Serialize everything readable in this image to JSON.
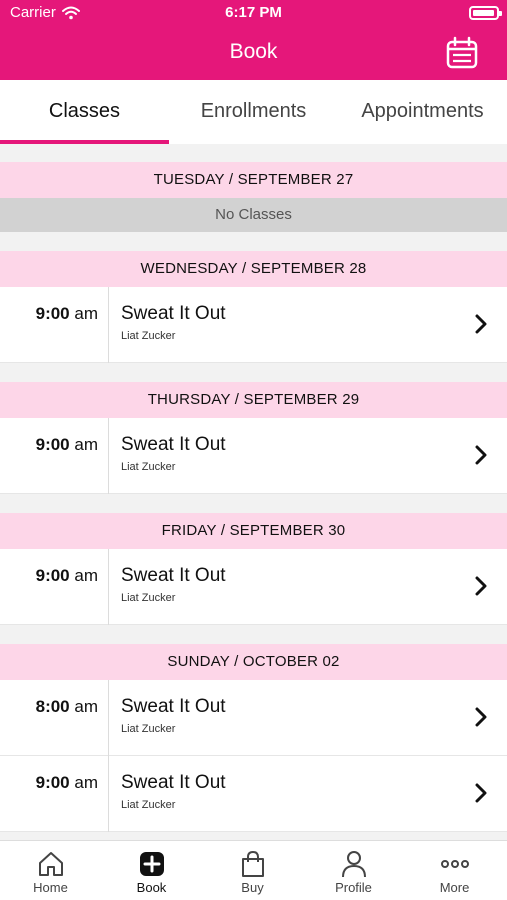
{
  "status_bar": {
    "carrier": "Carrier",
    "time": "6:17 PM"
  },
  "nav": {
    "title": "Book"
  },
  "tabs": [
    {
      "label": "Classes"
    },
    {
      "label": "Enrollments"
    },
    {
      "label": "Appointments"
    }
  ],
  "schedule": {
    "days": [
      {
        "header": "TUESDAY / SEPTEMBER 27",
        "empty_label": "No Classes"
      },
      {
        "header": "WEDNESDAY / SEPTEMBER 28",
        "classes": [
          {
            "time": "9:00",
            "ampm": "am",
            "name": "Sweat It Out",
            "instructor": "Liat Zucker"
          }
        ]
      },
      {
        "header": "THURSDAY / SEPTEMBER 29",
        "classes": [
          {
            "time": "9:00",
            "ampm": "am",
            "name": "Sweat It Out",
            "instructor": "Liat Zucker"
          }
        ]
      },
      {
        "header": "FRIDAY / SEPTEMBER 30",
        "classes": [
          {
            "time": "9:00",
            "ampm": "am",
            "name": "Sweat It Out",
            "instructor": "Liat Zucker"
          }
        ]
      },
      {
        "header": "SUNDAY / OCTOBER 02",
        "classes": [
          {
            "time": "8:00",
            "ampm": "am",
            "name": "Sweat It Out",
            "instructor": "Liat Zucker"
          },
          {
            "time": "9:00",
            "ampm": "am",
            "name": "Sweat It Out",
            "instructor": "Liat Zucker"
          }
        ]
      }
    ]
  },
  "tabbar": {
    "items": [
      {
        "label": "Home",
        "icon": "home-icon"
      },
      {
        "label": "Book",
        "icon": "plus-square-icon"
      },
      {
        "label": "Buy",
        "icon": "shopping-bag-icon"
      },
      {
        "label": "Profile",
        "icon": "person-icon"
      },
      {
        "label": "More",
        "icon": "ellipsis-icon"
      }
    ]
  },
  "colors": {
    "brand": "#e5177a",
    "day_header_bg": "#fdd6e8",
    "no_classes_bg": "#d2d2d2"
  }
}
